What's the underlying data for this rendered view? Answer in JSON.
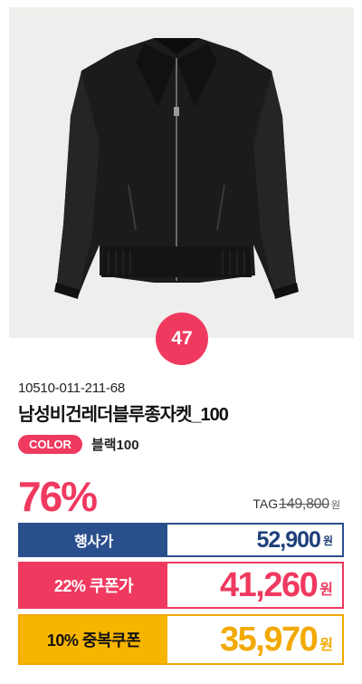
{
  "product": {
    "rank": "47",
    "code": "10510-011-211-68",
    "name": "남성비건레더블루종자켓_100",
    "color_label": "COLOR",
    "color_value": "블랙100",
    "image_icon": "jacket-image",
    "discount_percent": "76%",
    "tag_label": "TAG",
    "tag_price": "149,800",
    "tag_unit": "원"
  },
  "prices": {
    "event_label": "행사가",
    "event_price": "52,900",
    "coupon_label": "22% 쿠폰가",
    "coupon_price": "41,260",
    "double_coupon_label": "10% 중복쿠폰",
    "double_coupon_price": "35,970",
    "unit": "원"
  },
  "colors": {
    "accent_pink": "#f0395f",
    "navy": "#2a4f8d",
    "yellow": "#f7b500"
  }
}
